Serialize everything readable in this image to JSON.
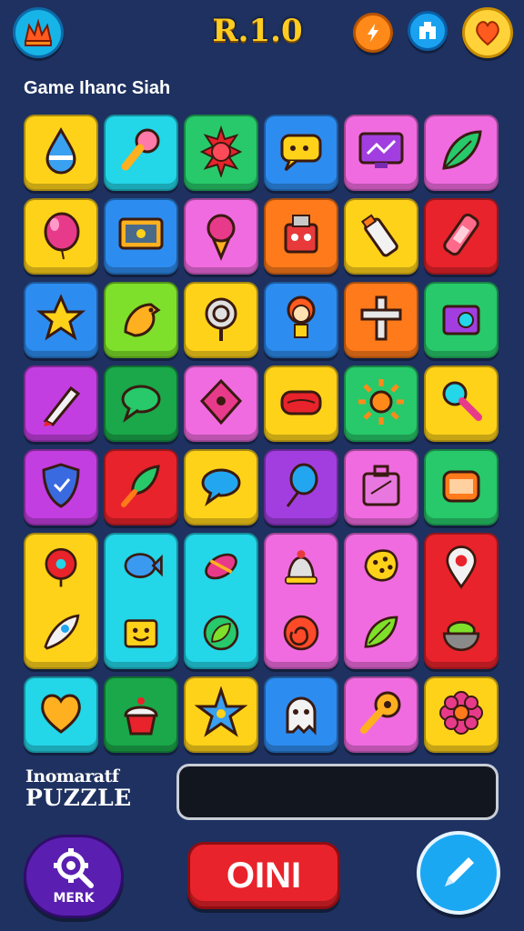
{
  "header": {
    "version": "R.1.0",
    "subtitle": "Game Ihanc Siah",
    "icons": [
      "crown-logo-icon",
      "bolt-icon",
      "building-icon",
      "heart-icon"
    ]
  },
  "board": {
    "rows": [
      [
        {
          "color": "#ffd21a",
          "icon": "water-drop-icon"
        },
        {
          "color": "#23d6e8",
          "icon": "key-icon"
        },
        {
          "color": "#27c96a",
          "icon": "sun-gem-icon"
        },
        {
          "color": "#2d8cf0",
          "icon": "chat-bubble-icon"
        },
        {
          "color": "#f06be0",
          "icon": "monitor-icon"
        },
        {
          "color": "#f06be0",
          "icon": "leaf-icon"
        }
      ],
      [
        {
          "color": "#ffd21a",
          "icon": "balloon-icon"
        },
        {
          "color": "#2d8cf0",
          "icon": "tv-icon"
        },
        {
          "color": "#f06be0",
          "icon": "ice-cream-icon"
        },
        {
          "color": "#ff7a1a",
          "icon": "robot-icon"
        },
        {
          "color": "#ffd21a",
          "icon": "bottle-icon"
        },
        {
          "color": "#e8232b",
          "icon": "bandage-icon"
        }
      ],
      [
        {
          "color": "#2d8cf0",
          "icon": "star-icon"
        },
        {
          "color": "#7ee02a",
          "icon": "bird-icon"
        },
        {
          "color": "#ffd21a",
          "icon": "microphone-icon"
        },
        {
          "color": "#2d8cf0",
          "icon": "flower-face-icon"
        },
        {
          "color": "#ff7a1a",
          "icon": "cross-icon"
        },
        {
          "color": "#27c96a",
          "icon": "speaker-icon"
        }
      ],
      [
        {
          "color": "#c33ee0",
          "icon": "brush-icon"
        },
        {
          "color": "#1aa84a",
          "icon": "speech-icon"
        },
        {
          "color": "#f06be0",
          "icon": "ladybug-icon"
        },
        {
          "color": "#ffd21a",
          "icon": "lips-icon"
        },
        {
          "color": "#27c96a",
          "icon": "sun-icon"
        },
        {
          "color": "#ffd21a",
          "icon": "magnifier-icon"
        }
      ],
      [
        {
          "color": "#c33ee0",
          "icon": "shield-icon"
        },
        {
          "color": "#e8232b",
          "icon": "leaf-brush-icon"
        },
        {
          "color": "#ffd21a",
          "icon": "comment-icon"
        },
        {
          "color": "#a23ee0",
          "icon": "balloon-pin-icon"
        },
        {
          "color": "#f06be0",
          "icon": "briefcase-icon"
        },
        {
          "color": "#27c96a",
          "icon": "can-icon"
        }
      ]
    ],
    "tall_row": [
      {
        "color": "#ffd21a",
        "icons": [
          "lollipop-icon",
          "rocket-icon"
        ]
      },
      {
        "color": "#23d6e8",
        "icons": [
          "fish-icon",
          "box-face-icon"
        ]
      },
      {
        "color": "#23d6e8",
        "icons": [
          "candy-icon",
          "leaf-circle-icon"
        ]
      },
      {
        "color": "#f06be0",
        "icons": [
          "bell-icon",
          "swirl-icon"
        ]
      },
      {
        "color": "#f06be0",
        "icons": [
          "cookie-icon",
          "leaf-badge-icon"
        ]
      },
      {
        "color": "#e8232b",
        "icons": [
          "location-pin-icon",
          "bowl-icon"
        ]
      }
    ],
    "last_row": [
      {
        "color": "#23d6e8",
        "icon": "heart-tile-icon"
      },
      {
        "color": "#1aa84a",
        "icon": "cupcake-icon"
      },
      {
        "color": "#ffd21a",
        "icon": "starfish-icon"
      },
      {
        "color": "#2d8cf0",
        "icon": "ghost-icon"
      },
      {
        "color": "#f06be0",
        "icon": "guitar-icon"
      },
      {
        "color": "#ffd21a",
        "icon": "flower-icon"
      }
    ]
  },
  "footer": {
    "label_line1": "Inomaratf",
    "label_line2": "PUZZLE",
    "input_value": "",
    "merk_label": "MERK",
    "go_label": "OINI"
  }
}
